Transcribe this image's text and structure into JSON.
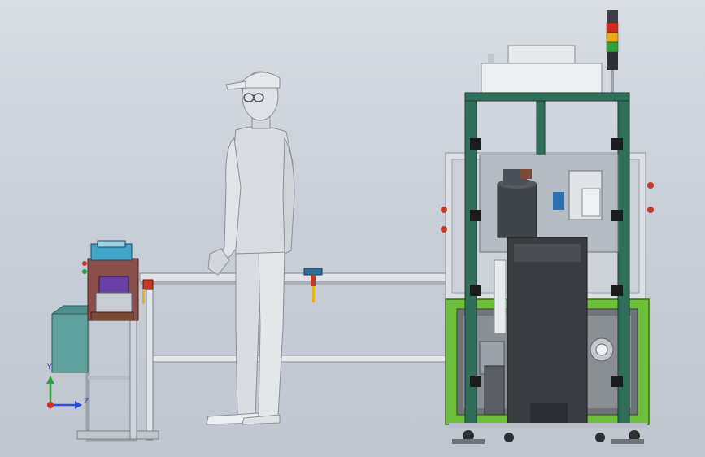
{
  "scene": {
    "axis_triad": {
      "y_label": "Y",
      "z_label": "Z"
    },
    "stack_light_colors": [
      "#d62a1f",
      "#e8a81c",
      "#2fa33a"
    ],
    "machine_frame_color": "#2f6f5a",
    "machine_base_color": "#6dbf3a"
  }
}
